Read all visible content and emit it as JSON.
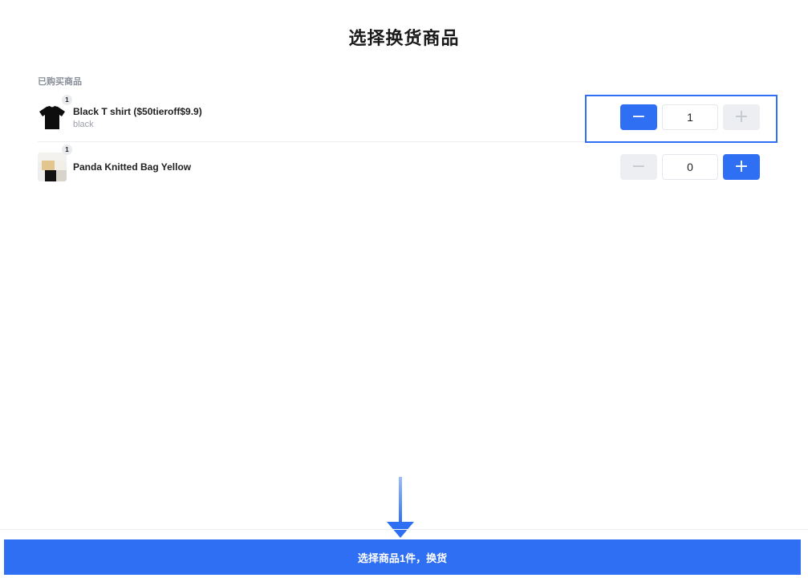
{
  "page": {
    "title": "选择换货商品"
  },
  "section": {
    "label": "已购买商品"
  },
  "items": [
    {
      "name": "Black T shirt ($50tieroff$9.9)",
      "variant": "black",
      "purchased_qty": "1",
      "selected_qty": "1",
      "minus_state": "active",
      "plus_state": "disabled",
      "thumbnail_icon": "black-tshirt-icon"
    },
    {
      "name": "Panda Knitted Bag Yellow",
      "variant": "",
      "purchased_qty": "1",
      "selected_qty": "0",
      "minus_state": "disabled",
      "plus_state": "active",
      "thumbnail_icon": "panda-bag-icon"
    }
  ],
  "stepper": {
    "minus_glyph": "−",
    "plus_glyph": "+"
  },
  "footer": {
    "submit_label": "选择商品1件，换货"
  },
  "colors": {
    "accent": "#2f6ff3",
    "disabled_bg": "#eceef2",
    "disabled_fg": "#c4c8cf",
    "muted_text": "#9aa0a8"
  }
}
